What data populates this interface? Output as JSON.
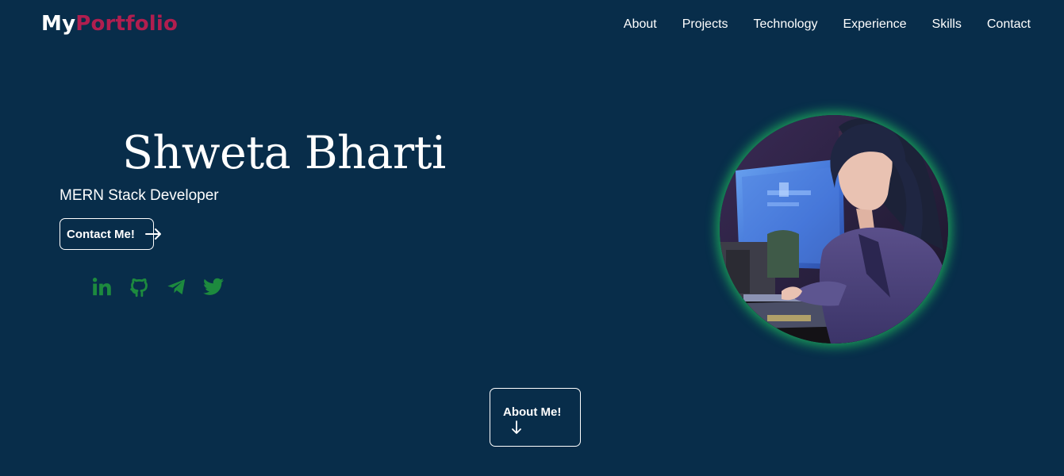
{
  "brand": {
    "part1": "My",
    "part2": "Portfolio"
  },
  "nav": {
    "items": [
      {
        "label": "About"
      },
      {
        "label": "Projects"
      },
      {
        "label": "Technology"
      },
      {
        "label": "Experience"
      },
      {
        "label": "Skills"
      },
      {
        "label": "Contact"
      }
    ]
  },
  "hero": {
    "name": "Shweta Bharti",
    "role": "MERN Stack Developer",
    "contact_button": "Contact Me!",
    "about_button": "About Me!"
  },
  "socials": [
    "linkedin-icon",
    "github-icon",
    "telegram-icon",
    "twitter-icon"
  ],
  "colors": {
    "background": "#082d4a",
    "brand_accent": "#b01e4f",
    "social_icons": "#1d8a3e",
    "avatar_glow": "#22c55e"
  }
}
